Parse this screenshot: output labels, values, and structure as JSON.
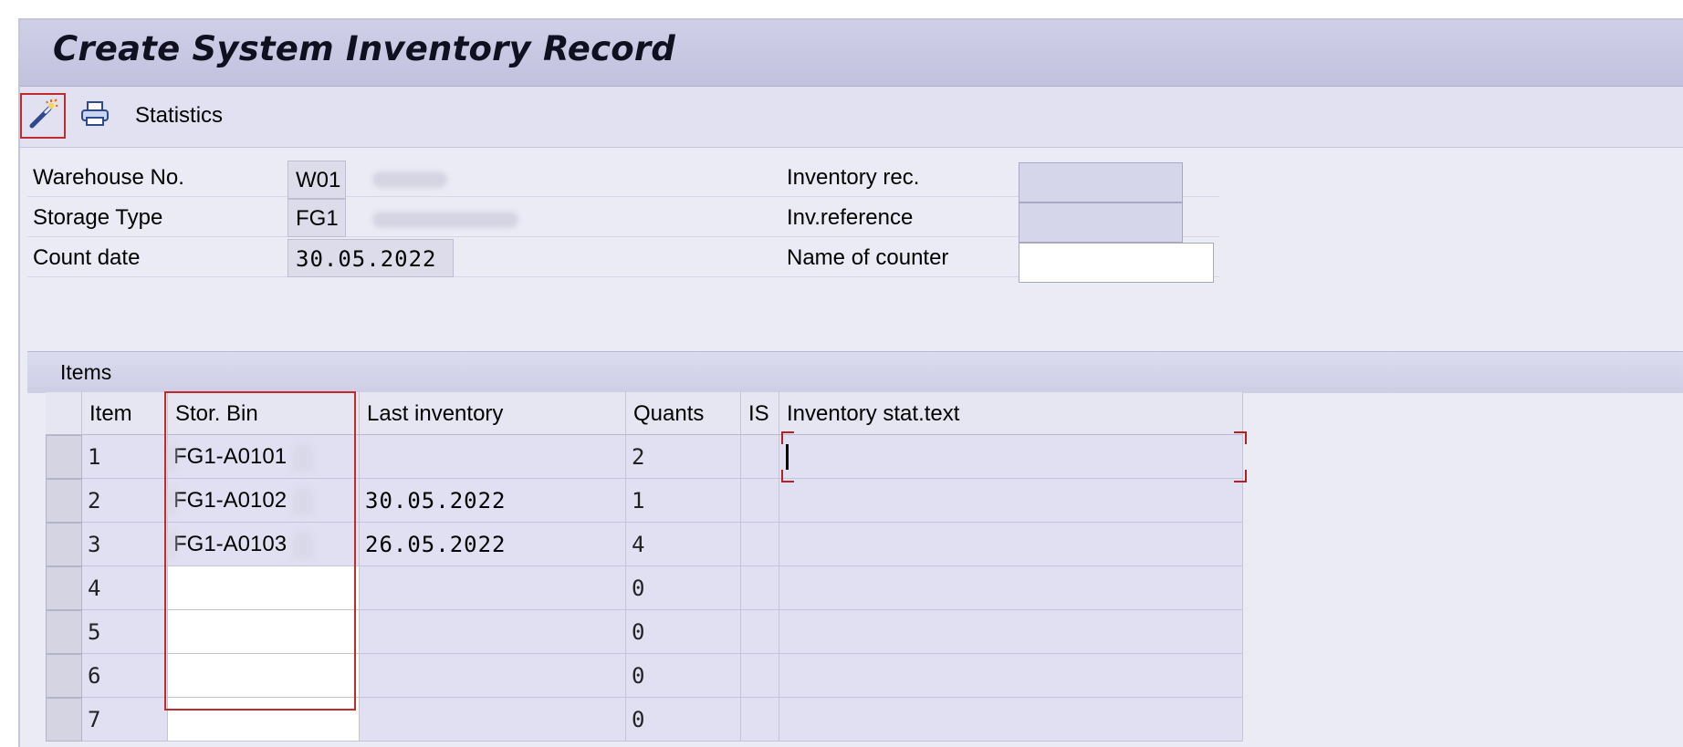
{
  "window": {
    "title": "Create System Inventory Record"
  },
  "toolbar": {
    "stats_label": "Statistics",
    "icons": [
      "magic-wand-icon",
      "print-icon"
    ]
  },
  "header": {
    "warehouse_label": "Warehouse No.",
    "warehouse_value": "W01",
    "storage_type_label": "Storage Type",
    "storage_type_value": "FG1",
    "count_date_label": "Count date",
    "count_date_value": "30.05.2022",
    "inv_rec_label": "Inventory rec.",
    "inv_ref_label": "Inv.reference",
    "counter_label": "Name of counter"
  },
  "items": {
    "title": "Items",
    "columns": [
      "Item",
      "Stor. Bin",
      "Last inventory",
      "Quants",
      "IS",
      "Inventory stat.text"
    ],
    "rows": [
      {
        "item": "1",
        "bin": "FG1-A0101",
        "last": "",
        "quants": "2"
      },
      {
        "item": "2",
        "bin": "FG1-A0102",
        "last": "30.05.2022",
        "quants": "1"
      },
      {
        "item": "3",
        "bin": "FG1-A0103",
        "last": "26.05.2022",
        "quants": "4"
      },
      {
        "item": "4",
        "bin": "",
        "last": "",
        "quants": "0"
      },
      {
        "item": "5",
        "bin": "",
        "last": "",
        "quants": "0"
      },
      {
        "item": "6",
        "bin": "",
        "last": "",
        "quants": "0"
      },
      {
        "item": "7",
        "bin": "",
        "last": "",
        "quants": "0"
      }
    ]
  },
  "colors": {
    "accent": "#c22b2b",
    "panel": "#ebebf6",
    "cell": "#e0e0f2"
  }
}
